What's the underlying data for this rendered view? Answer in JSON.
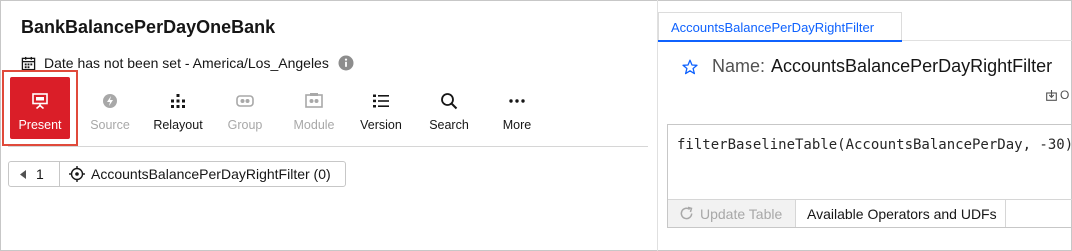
{
  "notebook": {
    "title": "BankBalancePerDayOneBank",
    "date_status": "Date has not been set - America/Los_Angeles"
  },
  "toolbar": {
    "present": "Present",
    "source": "Source",
    "relayout": "Relayout",
    "group": "Group",
    "module": "Module",
    "version": "Version",
    "search": "Search",
    "more": "More"
  },
  "breadcrumb": {
    "step": "1",
    "item": "AccountsBalancePerDayRightFilter (0)"
  },
  "right_panel": {
    "tab_label": "AccountsBalancePerDayRightFilter",
    "name_label": "Name:",
    "name_value": "AccountsBalancePerDayRightFilter",
    "overflow_label": "O",
    "code": "filterBaselineTable(AccountsBalancePerDay, -30)",
    "update_table": "Update Table",
    "operators": "Available Operators and UDFs"
  },
  "colors": {
    "present_bg": "#da1e28",
    "highlight_outline": "#e04a3b",
    "link_blue": "#0f62fe",
    "disabled": "#a8a8a8"
  },
  "icons": {
    "date": "calendar-icon",
    "info": "info-icon",
    "present": "presentation-icon",
    "source": "source-icon",
    "relayout": "relayout-icon",
    "group": "group-icon",
    "module": "module-icon",
    "version": "list-icon",
    "search": "search-icon",
    "more": "more-dots-icon",
    "breadcrumb_back": "caret-left-icon",
    "breadcrumb_target": "target-icon",
    "favorite": "star-icon",
    "export": "download-icon",
    "refresh": "refresh-icon"
  }
}
